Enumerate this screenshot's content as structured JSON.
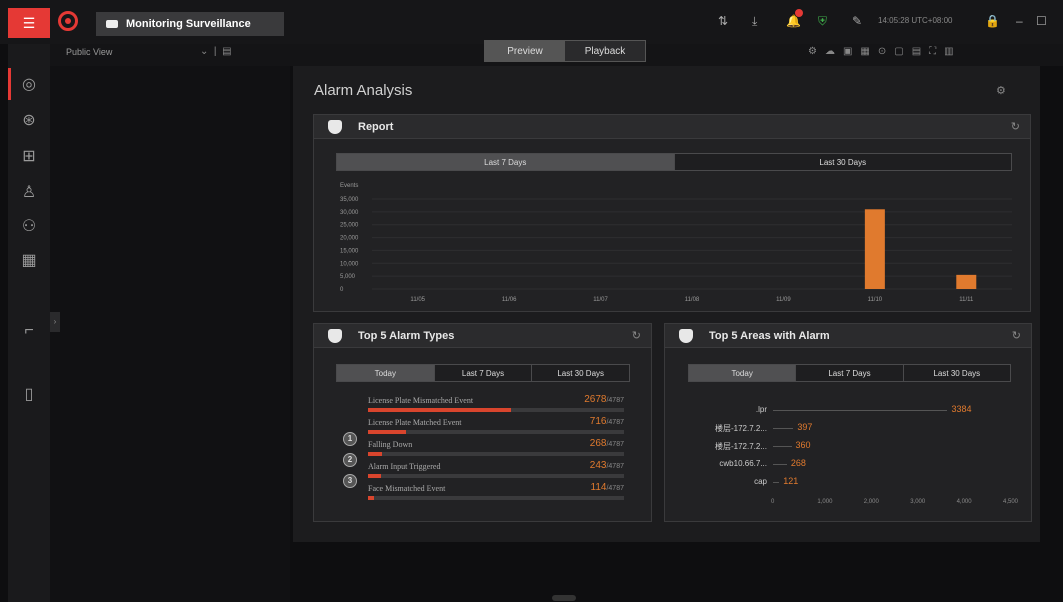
{
  "topbar": {
    "menu_icon": "hamburger-icon",
    "tab_title": "Monitoring Surveillance",
    "datetime": "14:05:28 UTC+08:00",
    "window_controls": [
      "lock-icon",
      "minimize-icon",
      "maximize-icon"
    ]
  },
  "subbar": {
    "view_label": "Public View",
    "mode_tabs": [
      {
        "label": "Preview",
        "selected": true
      },
      {
        "label": "Playback",
        "selected": false
      }
    ]
  },
  "main": {
    "title": "Alarm Analysis"
  },
  "report": {
    "title": "Report",
    "ranges": [
      {
        "label": "Last 7 Days",
        "selected": true
      },
      {
        "label": "Last 30 Days",
        "selected": false
      }
    ]
  },
  "chart_data": {
    "type": "bar",
    "ylabel": "Events",
    "ylim": [
      0,
      35000
    ],
    "yticks": [
      "35,000",
      "30,000",
      "25,000",
      "20,000",
      "15,000",
      "10,000",
      "5,000",
      "0"
    ],
    "categories": [
      "11/05",
      "11/06",
      "11/07",
      "11/08",
      "11/09",
      "11/10",
      "11/11"
    ],
    "values": [
      0,
      0,
      0,
      0,
      0,
      31000,
      5500
    ],
    "bar_color": "#e07a2e"
  },
  "alarm_types": {
    "title": "Top 5 Alarm Types",
    "ranges": [
      {
        "label": "Today",
        "selected": true
      },
      {
        "label": "Last 7 Days",
        "selected": false
      },
      {
        "label": "Last 30 Days",
        "selected": false
      }
    ],
    "total": "/4787",
    "items": [
      {
        "name": "License Plate Mismatched Event",
        "value": "2678",
        "fraction": 0.559
      },
      {
        "name": "License Plate Matched Event",
        "value": "716",
        "fraction": 0.15
      },
      {
        "name": "Falling Down",
        "value": "268",
        "fraction": 0.056
      },
      {
        "name": "Alarm Input Triggered",
        "value": "243",
        "fraction": 0.051
      },
      {
        "name": "Face Mismatched Event",
        "value": "114",
        "fraction": 0.024
      }
    ],
    "ranks": [
      "1",
      "2",
      "3"
    ]
  },
  "areas": {
    "title": "Top 5 Areas with Alarm",
    "ranges": [
      {
        "label": "Today",
        "selected": true
      },
      {
        "label": "Last 7 Days",
        "selected": false
      },
      {
        "label": "Last 30 Days",
        "selected": false
      }
    ],
    "items": [
      {
        "name": ".lpr",
        "value": "3384",
        "fraction": 0.752
      },
      {
        "name": "楼层-172.7.2...",
        "value": "397",
        "fraction": 0.088
      },
      {
        "name": "楼层-172.7.2...",
        "value": "360",
        "fraction": 0.08
      },
      {
        "name": "cwb10.66.7...",
        "value": "268",
        "fraction": 0.06
      },
      {
        "name": "cap",
        "value": "121",
        "fraction": 0.027
      }
    ],
    "xticks": [
      "0",
      "1,000",
      "2,000",
      "3,000",
      "4,000",
      "4,500"
    ]
  }
}
